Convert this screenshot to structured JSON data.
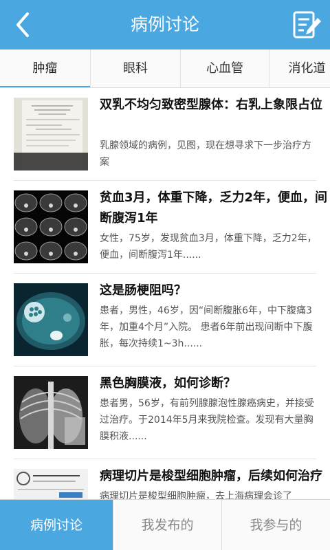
{
  "header": {
    "title": "病例讨论",
    "back_icon": "back-arrow-icon",
    "compose_icon": "compose-icon"
  },
  "tabs": [
    {
      "label": "肿瘤",
      "active": true
    },
    {
      "label": "眼科",
      "active": false
    },
    {
      "label": "心血管",
      "active": false
    },
    {
      "label": "消化道",
      "active": false
    }
  ],
  "cases": [
    {
      "title": "双乳不均匀致密型腺体：右乳上象限占位",
      "summary": "乳腺领域的病例，见图，现在想寻求下一步治疗方案",
      "thumb": "document-photo"
    },
    {
      "title": "贫血3月，体重下降，乏力2年，便血，间断腹泻1年",
      "summary": "女性，75岁，发现贫血3月，体重下降，乏力2年，便血，间断腹泻1年......",
      "thumb": "ct-scan-grid"
    },
    {
      "title": "这是肠梗阻吗？",
      "summary": "患者，男性，46岁，因“间断腹胀6年，中下腹痛3年，加重4个月”入院。 患者6年前出现间断中下腹胀，每次持续1~3h......",
      "thumb": "ct-scan-abdomen"
    },
    {
      "title": "黑色胸膜液，如何诊断？",
      "summary": "患者男，56岁，有前列腺腺泡性腺癌病史，并接受过治疗。于2014年5月来我院检查。发现有大量胸膜积液......",
      "thumb": "chest-xray"
    },
    {
      "title": "病理切片是梭型细胞肿瘤，后续如何治疗",
      "summary": "病理切片是梭型细胞肿瘤，去上海病理会诊了",
      "thumb": "pathology-report"
    }
  ],
  "bottom_nav": [
    {
      "label": "病例讨论",
      "active": true
    },
    {
      "label": "我发布的",
      "active": false
    },
    {
      "label": "我参与的",
      "active": false
    }
  ],
  "colors": {
    "primary": "#4aa7e0",
    "text": "#111111",
    "muted": "#555555"
  }
}
